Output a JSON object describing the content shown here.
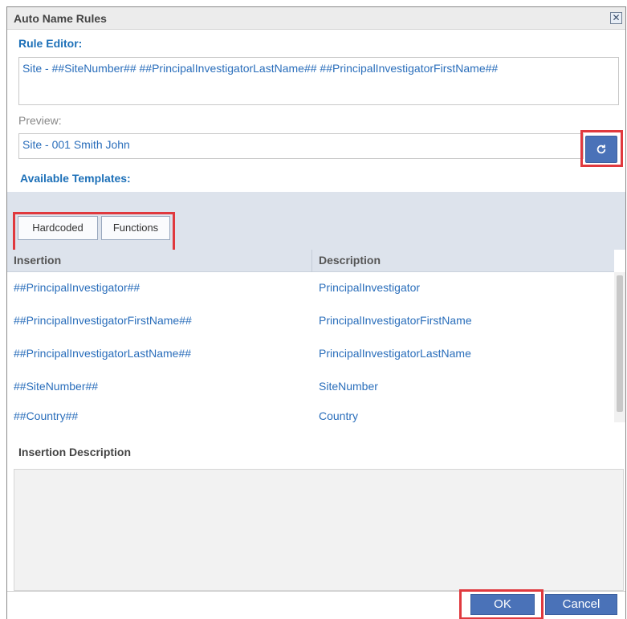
{
  "window": {
    "title": "Auto Name Rules",
    "close_glyph": "✕"
  },
  "rule_editor": {
    "label": "Rule Editor:",
    "value": "Site - ##SiteNumber## ##PrincipalInvestigatorLastName## ##PrincipalInvestigatorFirstName##"
  },
  "preview": {
    "label": "Preview:",
    "value": "Site - 001 Smith John",
    "refresh_icon": "refresh-icon"
  },
  "templates": {
    "label": "Available Templates:",
    "tabs": [
      {
        "label": "Hardcoded",
        "active": true
      },
      {
        "label": "Functions",
        "active": false
      }
    ],
    "columns": {
      "insertion": "Insertion",
      "description": "Description"
    },
    "rows": [
      {
        "insertion": "##PrincipalInvestigator##",
        "description": "PrincipalInvestigator"
      },
      {
        "insertion": "##PrincipalInvestigatorFirstName##",
        "description": "PrincipalInvestigatorFirstName"
      },
      {
        "insertion": "##PrincipalInvestigatorLastName##",
        "description": "PrincipalInvestigatorLastName"
      },
      {
        "insertion": "##SiteNumber##",
        "description": "SiteNumber"
      },
      {
        "insertion": "##Country##",
        "description": "Country"
      }
    ]
  },
  "insertion_description": {
    "label": "Insertion Description",
    "value": ""
  },
  "buttons": {
    "ok": "OK",
    "cancel": "Cancel"
  },
  "colors": {
    "accent": "#1d70b8",
    "link": "#2a6ebb",
    "button": "#4a72b8",
    "highlight": "#e0393e"
  }
}
